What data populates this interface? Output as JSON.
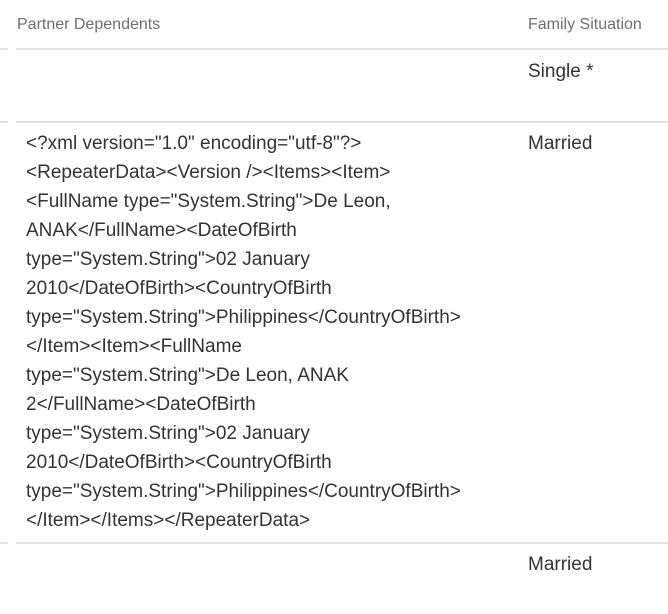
{
  "table": {
    "columns": [
      {
        "label": "Partner Dependents"
      },
      {
        "label": "Family Situation"
      }
    ],
    "rows": [
      {
        "partner_dependents": "",
        "family_situation": "Single *"
      },
      {
        "partner_dependents": "<?xml version=\"1.0\" encoding=\"utf-8\"?>\n<RepeaterData><Version /><Items><Item>\n<FullName type=\"System.String\">De Leon,\nANAK</FullName><DateOfBirth\ntype=\"System.String\">02 January\n2010</DateOfBirth><CountryOfBirth\ntype=\"System.String\">Philippines</CountryOfBirth>\n</Item><Item><FullName\ntype=\"System.String\">De Leon, ANAK\n2</FullName><DateOfBirth\ntype=\"System.String\">02 January\n2010</DateOfBirth><CountryOfBirth\ntype=\"System.String\">Philippines</CountryOfBirth>\n</Item></Items></RepeaterData>",
        "family_situation": "Married"
      },
      {
        "partner_dependents": "",
        "family_situation": "Married"
      }
    ]
  }
}
